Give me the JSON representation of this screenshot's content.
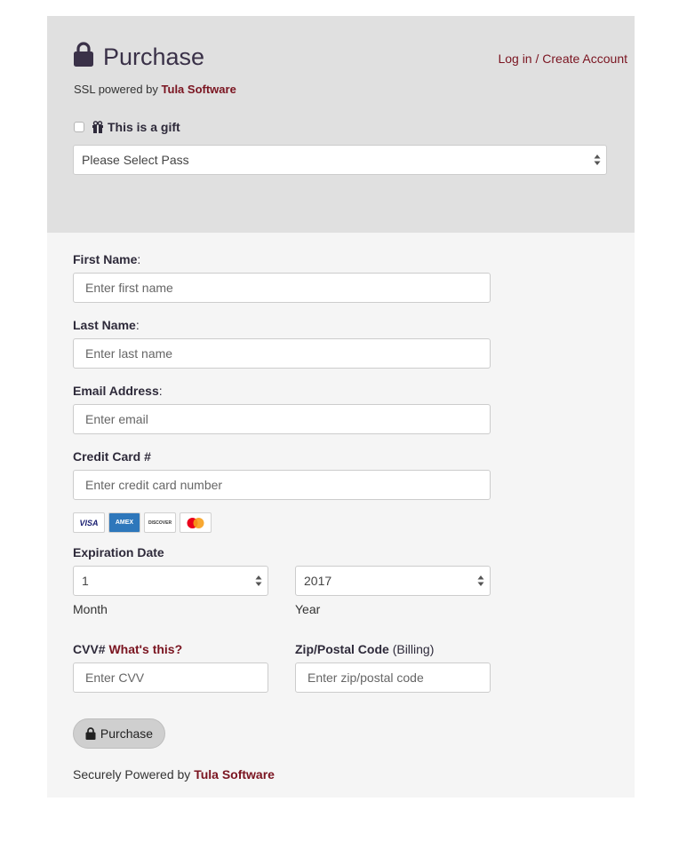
{
  "header": {
    "title": "Purchase",
    "login_link": "Log in / Create Account",
    "ssl_prefix": "SSL powered by ",
    "ssl_brand": "Tula Software",
    "gift_label": "This is a gift",
    "gift_checked": false,
    "pass_select": "Please Select Pass"
  },
  "form": {
    "first_name": {
      "label": "First Name",
      "suffix": ":",
      "placeholder": "Enter first name"
    },
    "last_name": {
      "label": "Last Name",
      "suffix": ":",
      "placeholder": "Enter last name"
    },
    "email": {
      "label": "Email Address",
      "suffix": ":",
      "placeholder": "Enter email"
    },
    "credit_card": {
      "label": "Credit Card #",
      "placeholder": "Enter credit card number"
    },
    "card_brands": [
      "VISA",
      "AMEX",
      "DISCOVER",
      "MASTERCARD"
    ],
    "expiration": {
      "label": "Expiration Date",
      "month_value": "1",
      "month_label": "Month",
      "year_value": "2017",
      "year_label": "Year"
    },
    "cvv": {
      "label": "CVV#",
      "help_link": "What's this?",
      "placeholder": "Enter CVV"
    },
    "zip": {
      "label": "Zip/Postal Code",
      "label_suffix": "(Billing)",
      "placeholder": "Enter zip/postal code"
    },
    "purchase_button": "Purchase"
  },
  "footer": {
    "prefix": "Securely Powered by ",
    "brand": "Tula Software"
  },
  "colors": {
    "accent": "#7a1420",
    "header_bg": "#e0e0e0",
    "form_bg": "#f5f5f5",
    "title": "#3a3148"
  }
}
